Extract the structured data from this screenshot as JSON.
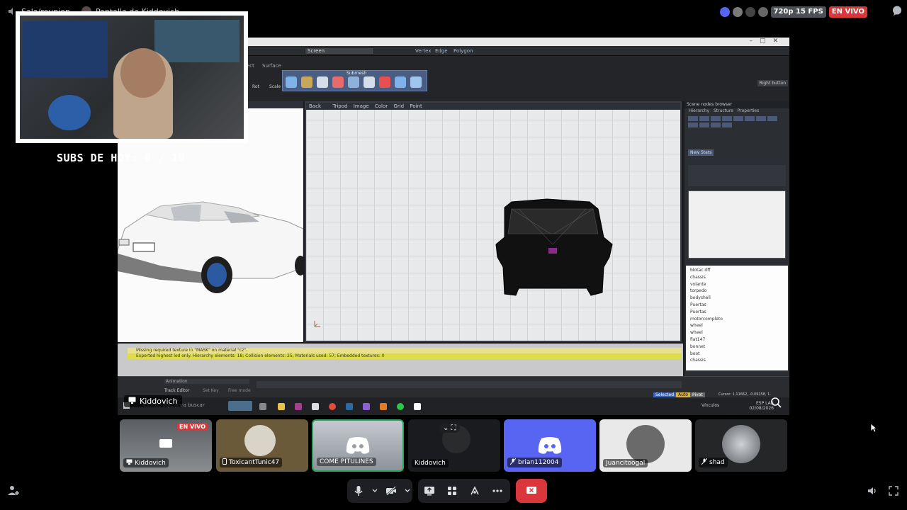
{
  "topbar": {
    "room_name": "Sala/reunion",
    "screen_label": "Pantalla de Kiddovich",
    "quality": "720p 15 FPS",
    "live": "EN VIVO"
  },
  "overlay": {
    "subs_text": "SUBS DE HOY: 0 / 10"
  },
  "editor": {
    "toolbar_field": "Screen",
    "toolbar_items": [
      "Vertex",
      "Edge",
      "Polygon"
    ],
    "tabs": [
      "ject",
      "Surface"
    ],
    "ribbon_title": "Subrnesh",
    "ribbon_labels": [
      "Rot",
      "Scale"
    ],
    "right_button": "Right button",
    "viewport_header": "Back",
    "viewport_menu": [
      "Tripod",
      "Image",
      "Color",
      "Grid",
      "Point"
    ],
    "side_title": "Scene nodes browser",
    "side_tabs": [
      "Hierarchy",
      "Structure",
      "Properties"
    ],
    "side_button": "New Stats",
    "nodes": [
      "blotac.dff",
      "chassis",
      "volante",
      "torpedo",
      "bodyshell",
      "Puertas",
      "Puertas",
      "motorcompleto",
      "wheel",
      "wheel",
      "fiat147",
      "bonnet",
      "boot",
      "chassis"
    ],
    "console_lines": [
      "Missing required texture in \"MASK\" on material \"cz\".",
      "Exported highest lod only. Hierarchy elements: 18; Collision elements: 25; Materials used: 57; Embedded textures: 0"
    ],
    "timeline_label": "Animation",
    "timeline_tabs": [
      "Track Editor",
      "Set Key",
      "Free mode"
    ],
    "status_items": [
      "Selected",
      "Auto",
      "Pivot"
    ],
    "cursor_readout": "Cursor: 1.11662, -0.09158, 1.",
    "taskbar_search": "Escribe aquí para buscar",
    "taskbar_weather": "Vínculos",
    "clock_lang": "ESP LAA",
    "clock_date": "02/08/2026"
  },
  "stream_label": "Kiddovich",
  "tiles": [
    {
      "name": "Kiddovich",
      "live": "EN VIVO",
      "icon": "screen-icon"
    },
    {
      "name": "ToxicantTunic47",
      "icon": "phone-icon"
    },
    {
      "name": "COME PITULINES",
      "icon": ""
    },
    {
      "name": "Kiddovich",
      "icon": ""
    },
    {
      "name": "brian112004",
      "icon": "mute-icon"
    },
    {
      "name": "Juancitoogal",
      "icon": ""
    },
    {
      "name": "shad",
      "icon": "mute-icon"
    }
  ],
  "colors": {
    "discord_blurple": "#5865f2",
    "live_red": "#da373c",
    "speaking_green": "#23a55a"
  }
}
